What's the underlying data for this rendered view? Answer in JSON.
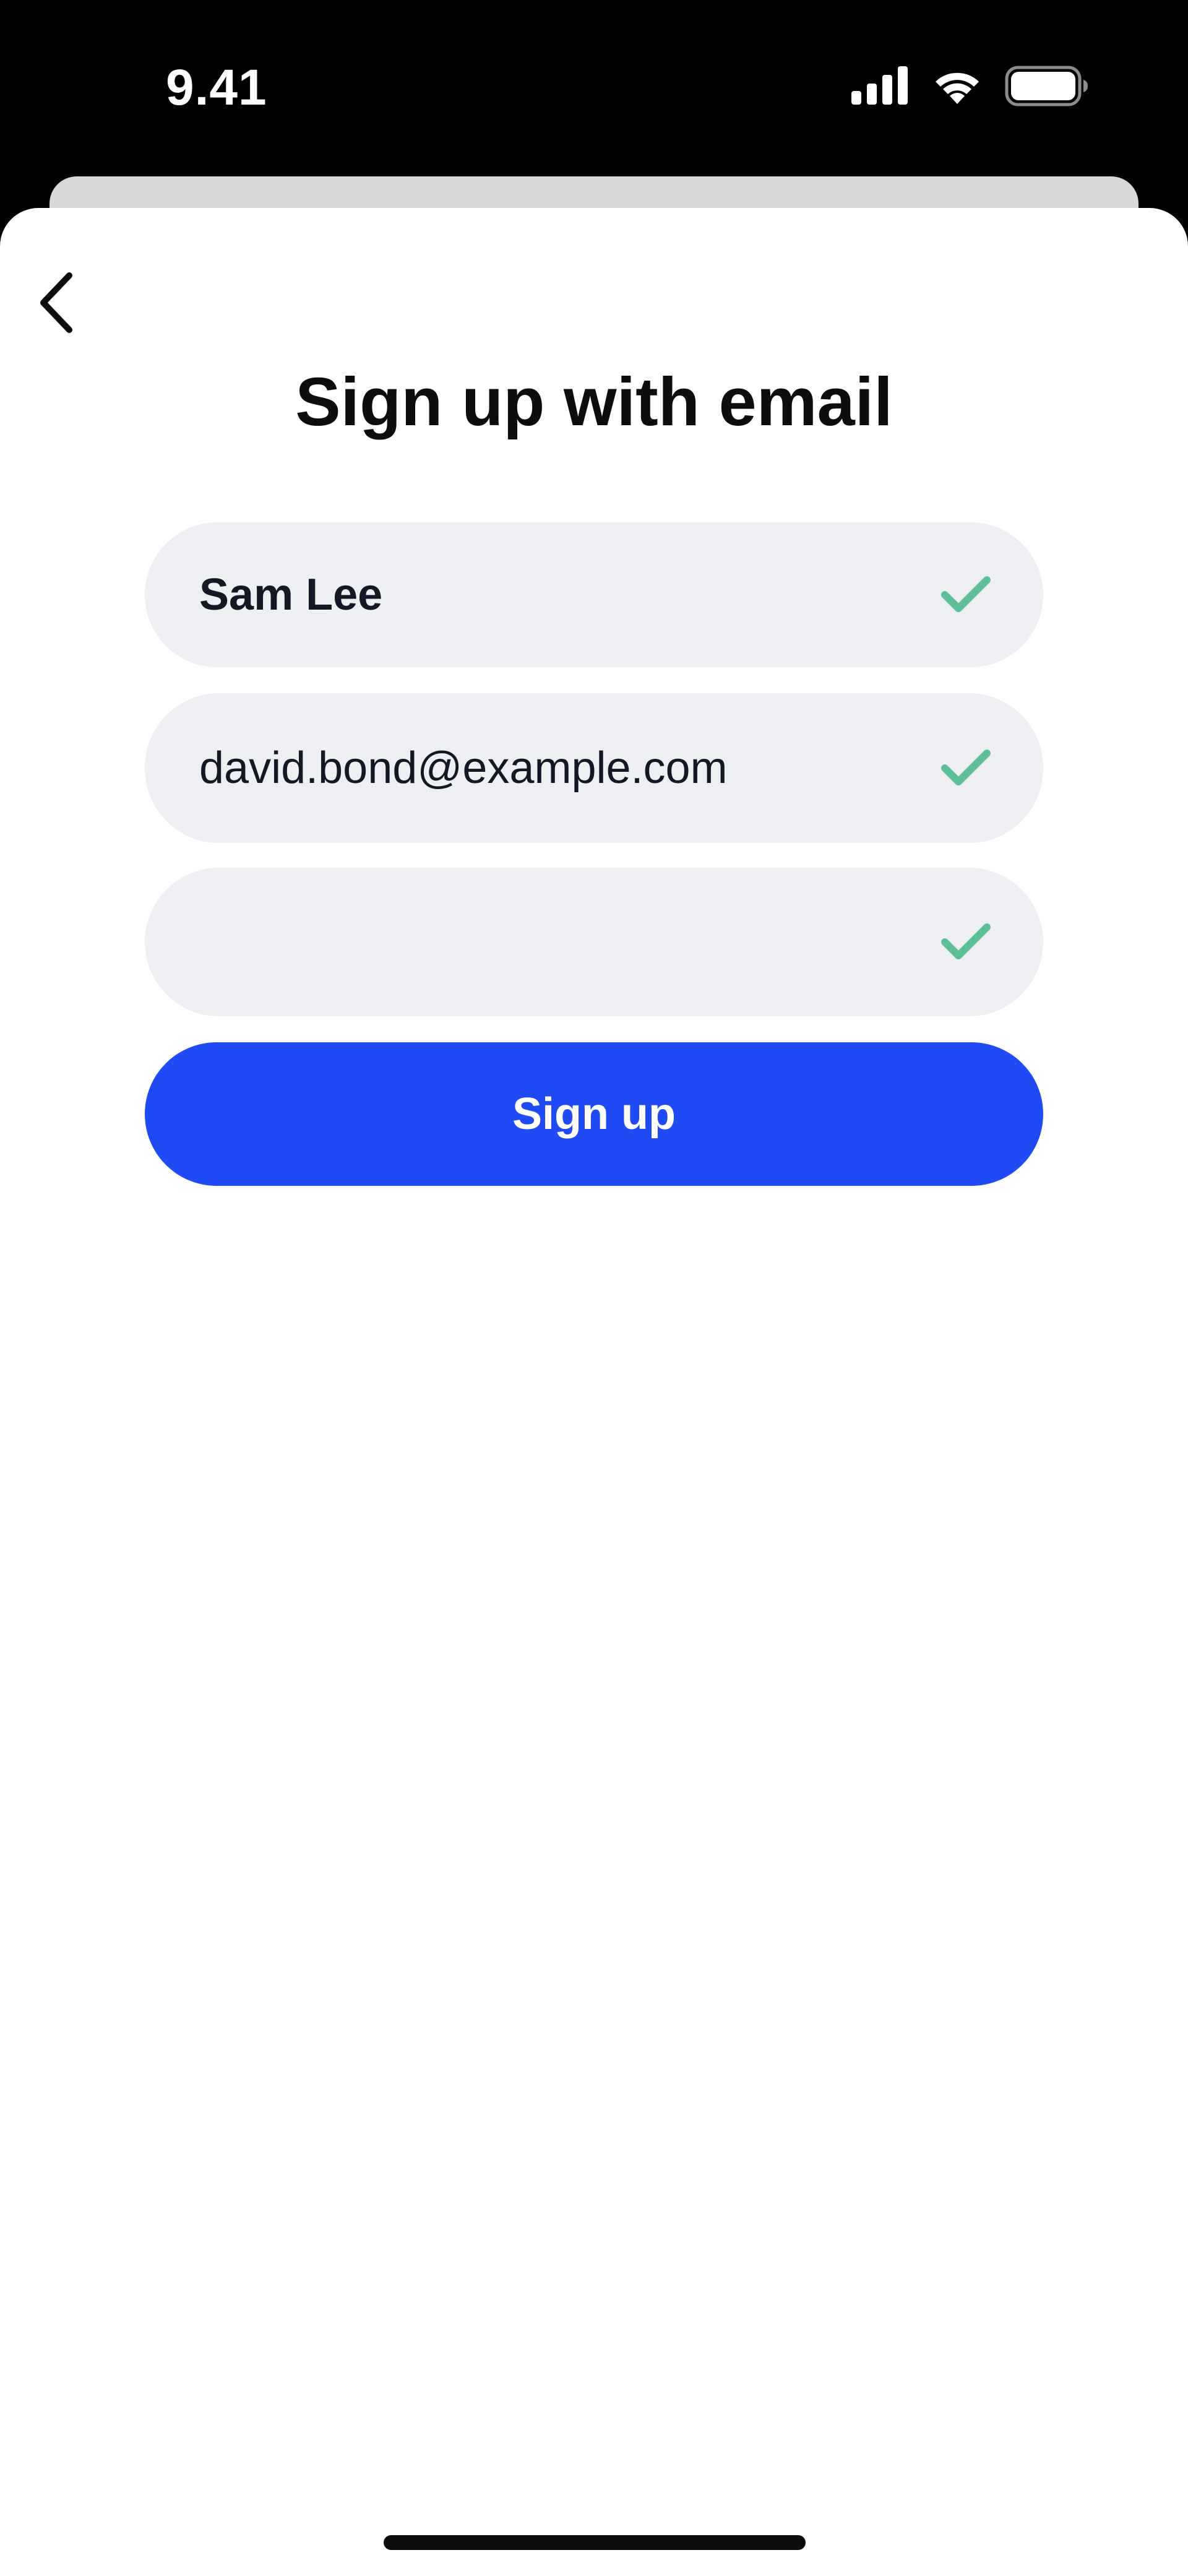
{
  "status_bar": {
    "time": "9.41",
    "icons": [
      "cellular-signal-icon",
      "wifi-icon",
      "battery-icon"
    ]
  },
  "header": {
    "back_icon": "chevron-left-icon",
    "title": "Sign up with email"
  },
  "form": {
    "name_field": {
      "value": "Sam Lee",
      "valid": true
    },
    "email_field": {
      "value": "david.bond@example.com",
      "valid": true
    },
    "password_field": {
      "value": "",
      "valid": true
    },
    "submit_label": "Sign up"
  },
  "colors": {
    "accent": "#1f4af4",
    "check": "#5dbf98",
    "field_background": "#eeeff3"
  }
}
